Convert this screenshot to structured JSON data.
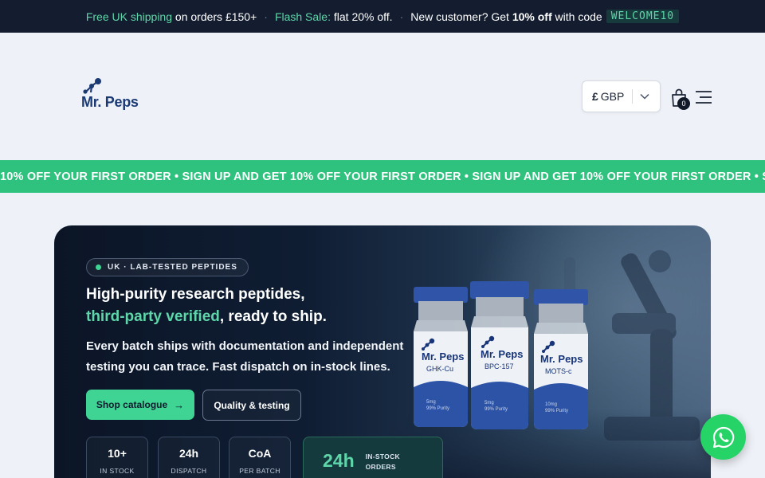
{
  "announcement": {
    "shipping_highlight": "Free UK shipping",
    "shipping_rest": "on orders £150+",
    "sale_highlight": "Flash Sale:",
    "sale_rest": "flat 20% off.",
    "new_customer_prefix": "New customer? Get",
    "new_customer_bold": "10% off",
    "new_customer_suffix": "with code",
    "code": "WELCOME10",
    "separator": "·"
  },
  "header": {
    "logo_text": "Mr. Peps",
    "currency_symbol": "£",
    "currency_code": "GBP",
    "cart_count": "0",
    "icons": [
      "molecule-logo-icon",
      "chevron-down-icon",
      "shopping-bag-icon",
      "menu-icon"
    ]
  },
  "marquee": {
    "text": "10% OFF YOUR FIRST ORDER • SIGN UP AND GET 10% OFF YOUR FIRST ORDER • SIGN UP AND GET 10% OFF YOUR FIRST ORDER • SIGN UP AND GET"
  },
  "hero": {
    "badge": "UK · LAB-TESTED PEPTIDES",
    "headline_line1": "High-purity research peptides,",
    "headline_accent": "third-party verified",
    "headline_rest": ", ready to ship.",
    "subtext": "Every batch ships with documentation and independent testing you can trace. Fast dispatch on in-stock lines.",
    "primary_button": "Shop catalogue",
    "secondary_button": "Quality & testing",
    "stats": [
      {
        "value": "10+",
        "label": "IN STOCK"
      },
      {
        "value": "24h",
        "label": "DISPATCH"
      },
      {
        "value": "CoA",
        "label": "PER BATCH"
      }
    ],
    "highlight_stat": {
      "value": "24h",
      "label_line1": "IN-STOCK",
      "label_line2": "ORDERS"
    },
    "vials": [
      {
        "brand": "Mr. Peps",
        "name": "GHK-Cu",
        "dose": "5mg",
        "purity": "99% Purity"
      },
      {
        "brand": "Mr. Peps",
        "name": "BPC-157",
        "dose": "5mg",
        "purity": "99% Purity"
      },
      {
        "brand": "Mr. Peps",
        "name": "MOTS-c",
        "dose": "10mg",
        "purity": "99% Purity"
      }
    ]
  },
  "colors": {
    "accent_green": "#3fd494",
    "marquee_green": "#2ec27e",
    "navy": "#141d2f",
    "brand_blue": "#1b3a73",
    "whatsapp": "#25d366"
  }
}
